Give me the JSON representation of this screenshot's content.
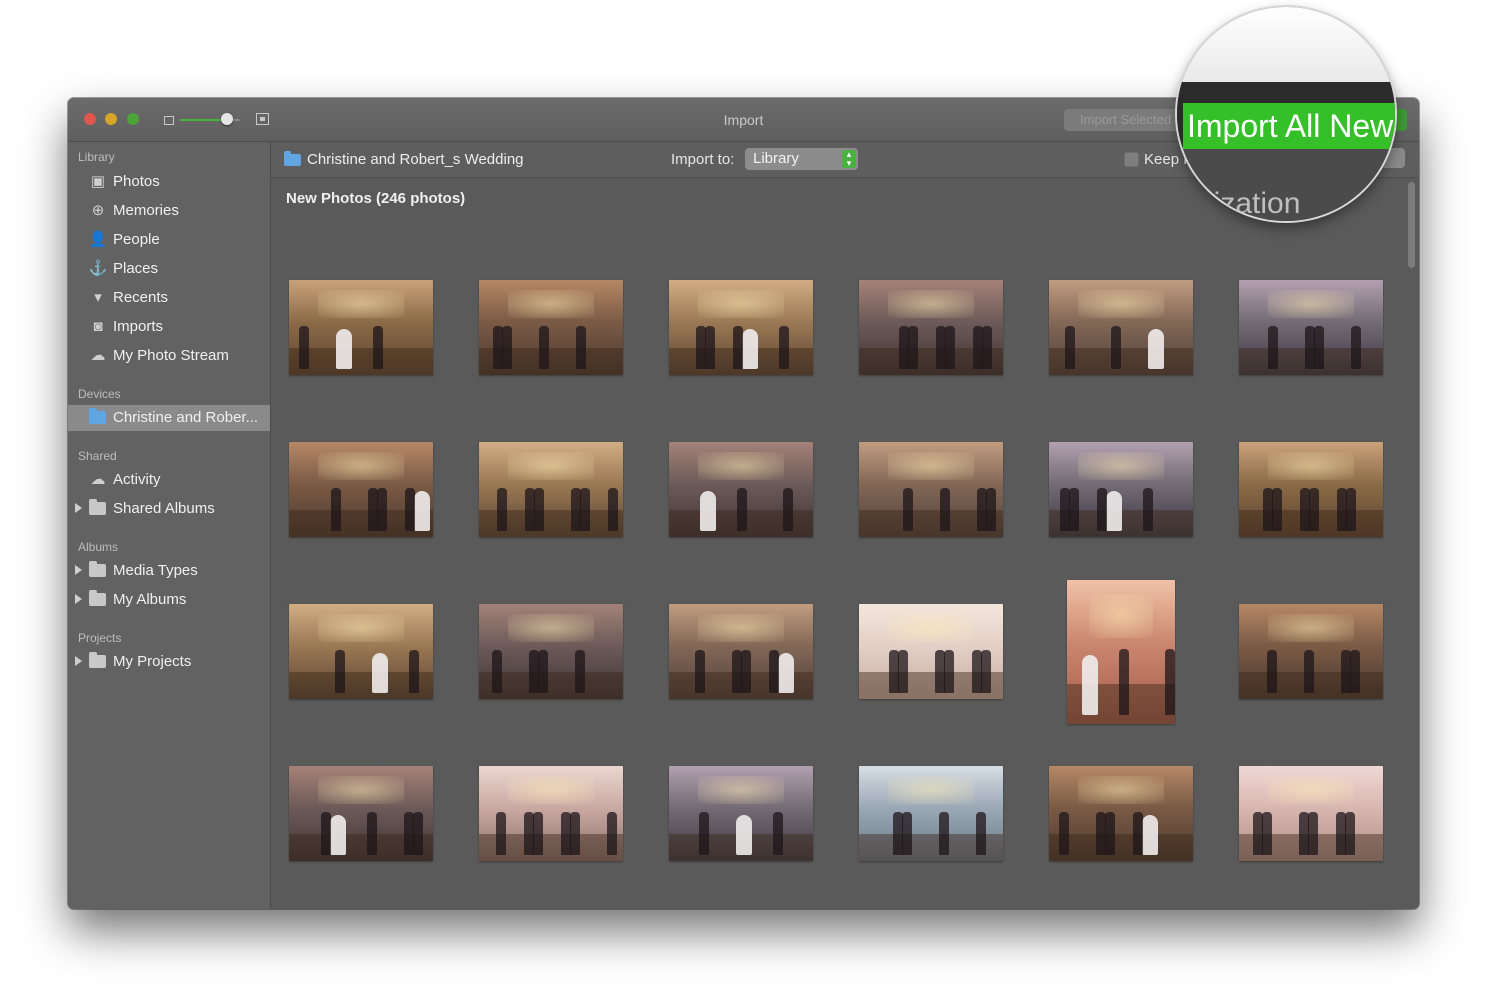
{
  "window": {
    "title": "Import",
    "import_selected_label": "Import Selected",
    "import_all_label": "Import All New Items"
  },
  "sidebar": {
    "library_header": "Library",
    "library_items": [
      {
        "label": "Photos",
        "icon": "photos-icon"
      },
      {
        "label": "Memories",
        "icon": "memories-icon"
      },
      {
        "label": "People",
        "icon": "people-icon"
      },
      {
        "label": "Places",
        "icon": "places-icon"
      },
      {
        "label": "Recents",
        "icon": "recents-icon"
      },
      {
        "label": "Imports",
        "icon": "imports-icon"
      },
      {
        "label": "My Photo Stream",
        "icon": "cloud-icon"
      }
    ],
    "devices_header": "Devices",
    "device_item": "Christine and Rober...",
    "shared_header": "Shared",
    "shared_items": [
      "Activity",
      "Shared Albums"
    ],
    "albums_header": "Albums",
    "albums_items": [
      "Media Types",
      "My Albums"
    ],
    "projects_header": "Projects",
    "projects_items": [
      "My Projects"
    ]
  },
  "toolbar": {
    "source_name": "Christine and Robert_s Wedding",
    "import_to_label": "Import to:",
    "import_to_value": "Library",
    "keep_label": "Keep Folder Organization"
  },
  "content": {
    "section_title": "New Photos (246 photos)"
  },
  "magnifier": {
    "button_text": "Import All New",
    "partial_text": "nization"
  },
  "colors": {
    "accent_green": "#35c02a",
    "folder_blue": "#5fa6e3",
    "window_bg": "#5a5a5a"
  }
}
